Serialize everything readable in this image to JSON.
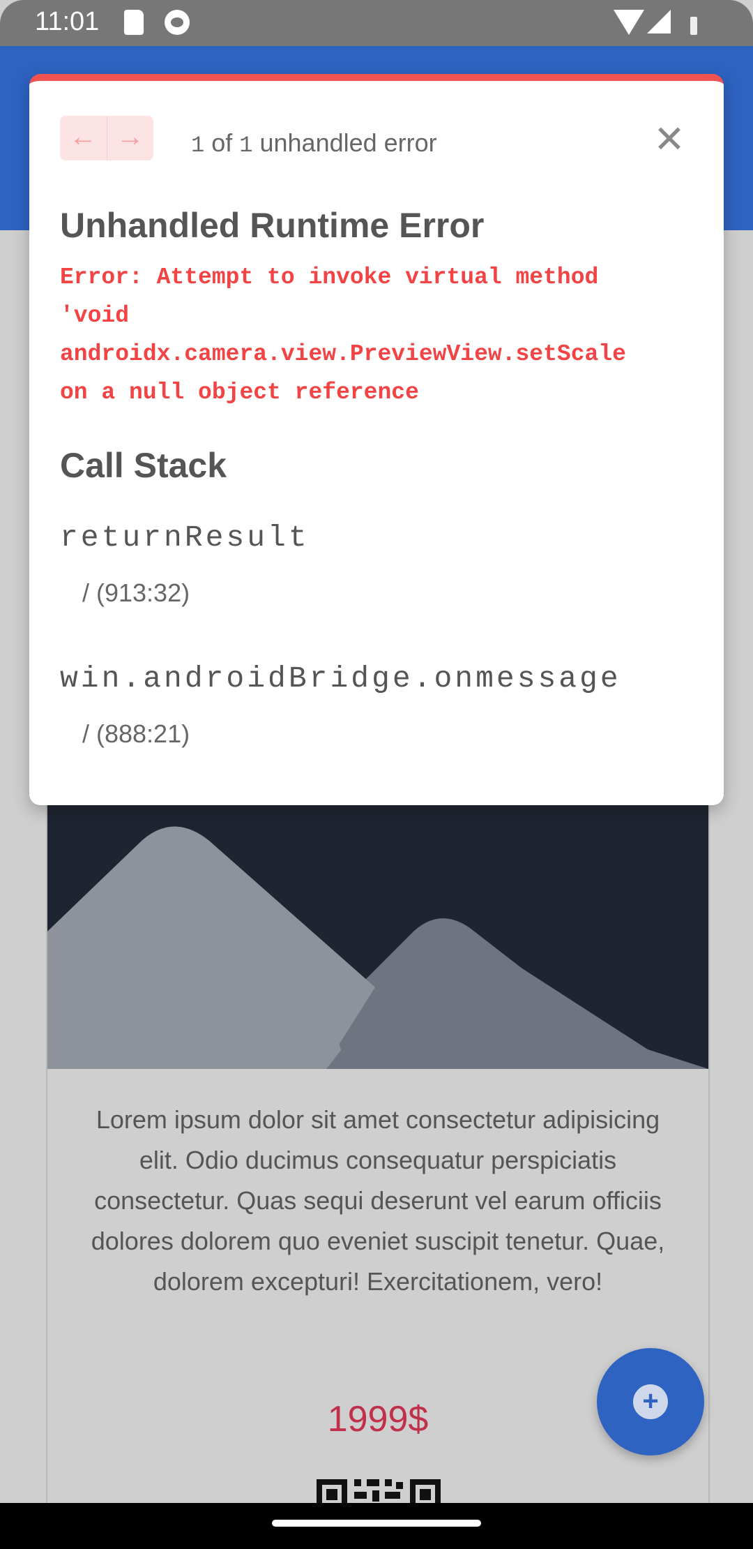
{
  "status_bar": {
    "time": "11:01"
  },
  "error_overlay": {
    "counter": {
      "current": "1",
      "of": "of",
      "total": "1",
      "suffix": "unhandled error"
    },
    "title": "Unhandled Runtime Error",
    "message": "Error: Attempt to invoke virtual method\n'void\nandroidx.camera.view.PreviewView.setScale\non a null object reference",
    "call_stack_title": "Call Stack",
    "frames": [
      {
        "function": "returnResult",
        "location": "/ (913:32)"
      },
      {
        "function": "win.androidBridge.onmessage",
        "location": "/ (888:21)"
      }
    ],
    "accent_color": "#f05151"
  },
  "card": {
    "description": "Lorem ipsum dolor sit amet consectetur adipisicing elit. Odio ducimus consequatur perspiciatis consectetur. Quas sequi deserunt vel earum officiis dolores dolorem quo eveniet suscipit tenetur. Quae, dolorem excepturi! Exercitationem, vero!",
    "price": "1999$"
  },
  "colors": {
    "app_bar": "#2e63c2",
    "price": "#c0304a",
    "fab": "#2e63c2"
  },
  "icons": {
    "prev": "arrow-left-icon",
    "next": "arrow-right-icon",
    "close": "close-icon",
    "fab": "plus-icon",
    "image": "mountain-placeholder-icon",
    "qr": "qr-code-icon"
  }
}
